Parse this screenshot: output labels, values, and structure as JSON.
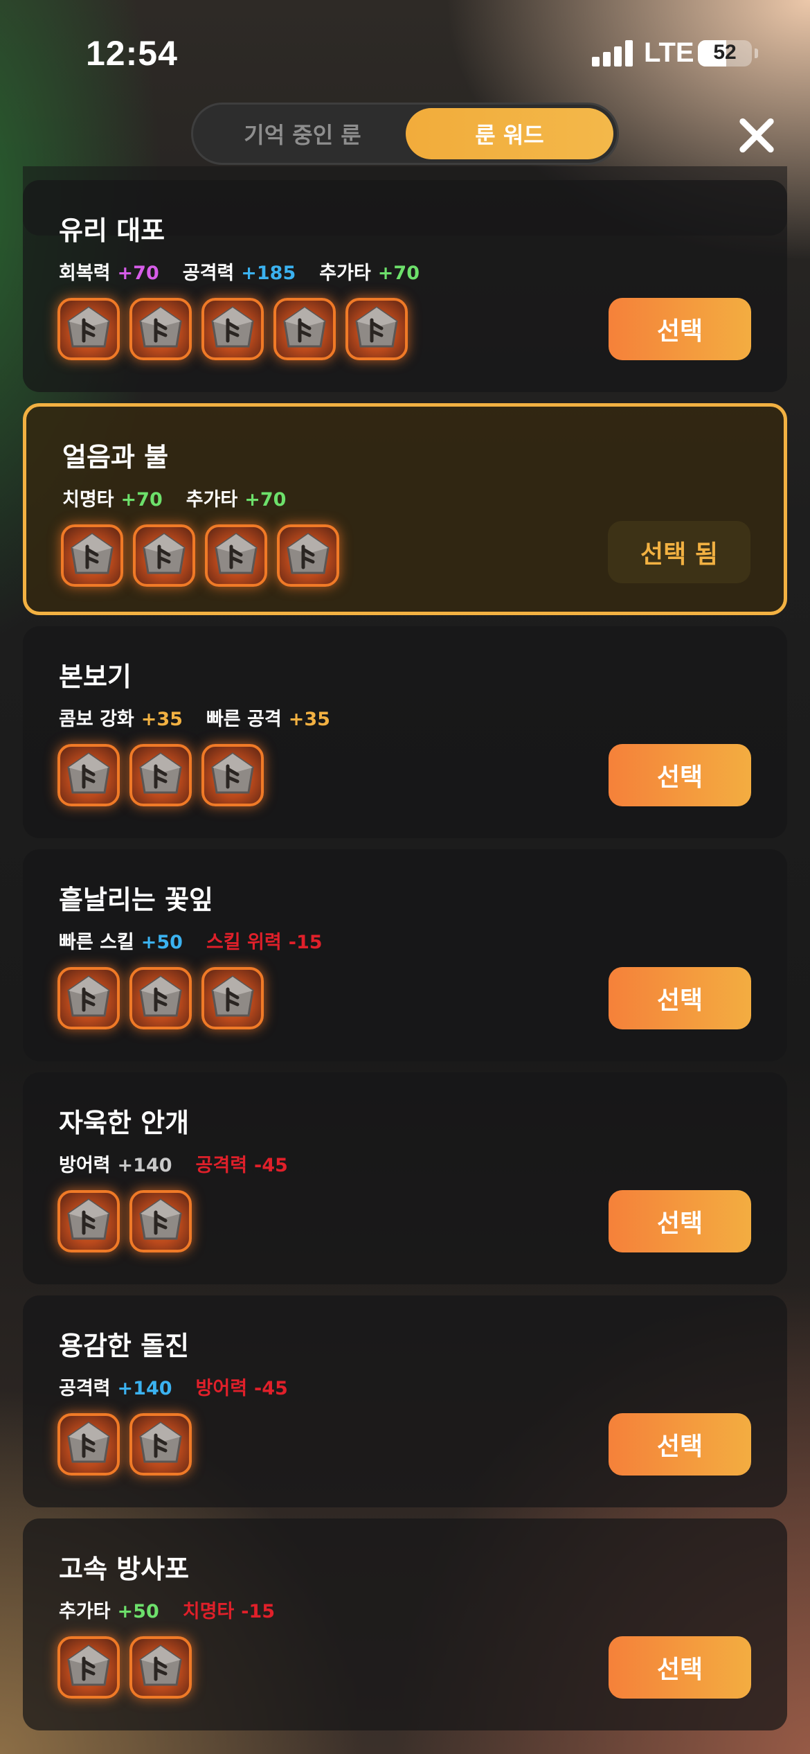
{
  "status_bar": {
    "time": "12:54",
    "network": "LTE",
    "battery": "52",
    "battery_level": 0.52
  },
  "tabs": [
    {
      "label": "기억 중인 룬",
      "active": false
    },
    {
      "label": "룬 워드",
      "active": true
    }
  ],
  "close_icon": "close-icon",
  "colors": {
    "accent": "#f2b142",
    "button": "#f5813a",
    "negative": "#e0202a",
    "positive": "#6de06b",
    "blue": "#3bb2f0",
    "purple": "#d65de8"
  },
  "runewords": [
    {
      "name": "유리 대포",
      "stats": [
        {
          "name": "회복력",
          "value": "+70",
          "color": "purple"
        },
        {
          "name": "공격력",
          "value": "+185",
          "color": "blue"
        },
        {
          "name": "추가타",
          "value": "+70",
          "color": "green"
        }
      ],
      "runes": [
        "rune-icon",
        "rune-icon",
        "rune-icon",
        "rune-icon",
        "rune-icon"
      ],
      "button": "선택",
      "selected": false
    },
    {
      "name": "얼음과 불",
      "stats": [
        {
          "name": "치명타",
          "value": "+70",
          "color": "green"
        },
        {
          "name": "추가타",
          "value": "+70",
          "color": "green"
        }
      ],
      "runes": [
        "rune-icon",
        "rune-icon",
        "rune-icon",
        "rune-icon"
      ],
      "button": "선택 됨",
      "selected": true
    },
    {
      "name": "본보기",
      "stats": [
        {
          "name": "콤보 강화",
          "value": "+35",
          "color": "orange"
        },
        {
          "name": "빠른 공격",
          "value": "+35",
          "color": "orange"
        }
      ],
      "runes": [
        "rune-icon",
        "rune-icon",
        "rune-icon"
      ],
      "button": "선택",
      "selected": false
    },
    {
      "name": "흩날리는 꽃잎",
      "stats": [
        {
          "name": "빠른 스킬",
          "value": "+50",
          "color": "blue"
        },
        {
          "name": "스킬 위력",
          "value": "-15",
          "color": "red",
          "name_color": "red"
        }
      ],
      "runes": [
        "rune-icon",
        "rune-icon",
        "rune-icon"
      ],
      "button": "선택",
      "selected": false
    },
    {
      "name": "자욱한 안개",
      "stats": [
        {
          "name": "방어력",
          "value": "+140",
          "color": "gray"
        },
        {
          "name": "공격력",
          "value": "-45",
          "color": "red",
          "name_color": "red"
        }
      ],
      "runes": [
        "rune-icon",
        "rune-icon"
      ],
      "button": "선택",
      "selected": false
    },
    {
      "name": "용감한 돌진",
      "stats": [
        {
          "name": "공격력",
          "value": "+140",
          "color": "blue"
        },
        {
          "name": "방어력",
          "value": "-45",
          "color": "red",
          "name_color": "red"
        }
      ],
      "runes": [
        "rune-icon",
        "rune-icon"
      ],
      "button": "선택",
      "selected": false
    },
    {
      "name": "고속 방사포",
      "stats": [
        {
          "name": "추가타",
          "value": "+50",
          "color": "green"
        },
        {
          "name": "치명타",
          "value": "-15",
          "color": "red",
          "name_color": "red"
        }
      ],
      "runes": [
        "rune-icon",
        "rune-icon"
      ],
      "button": "선택",
      "selected": false
    }
  ]
}
